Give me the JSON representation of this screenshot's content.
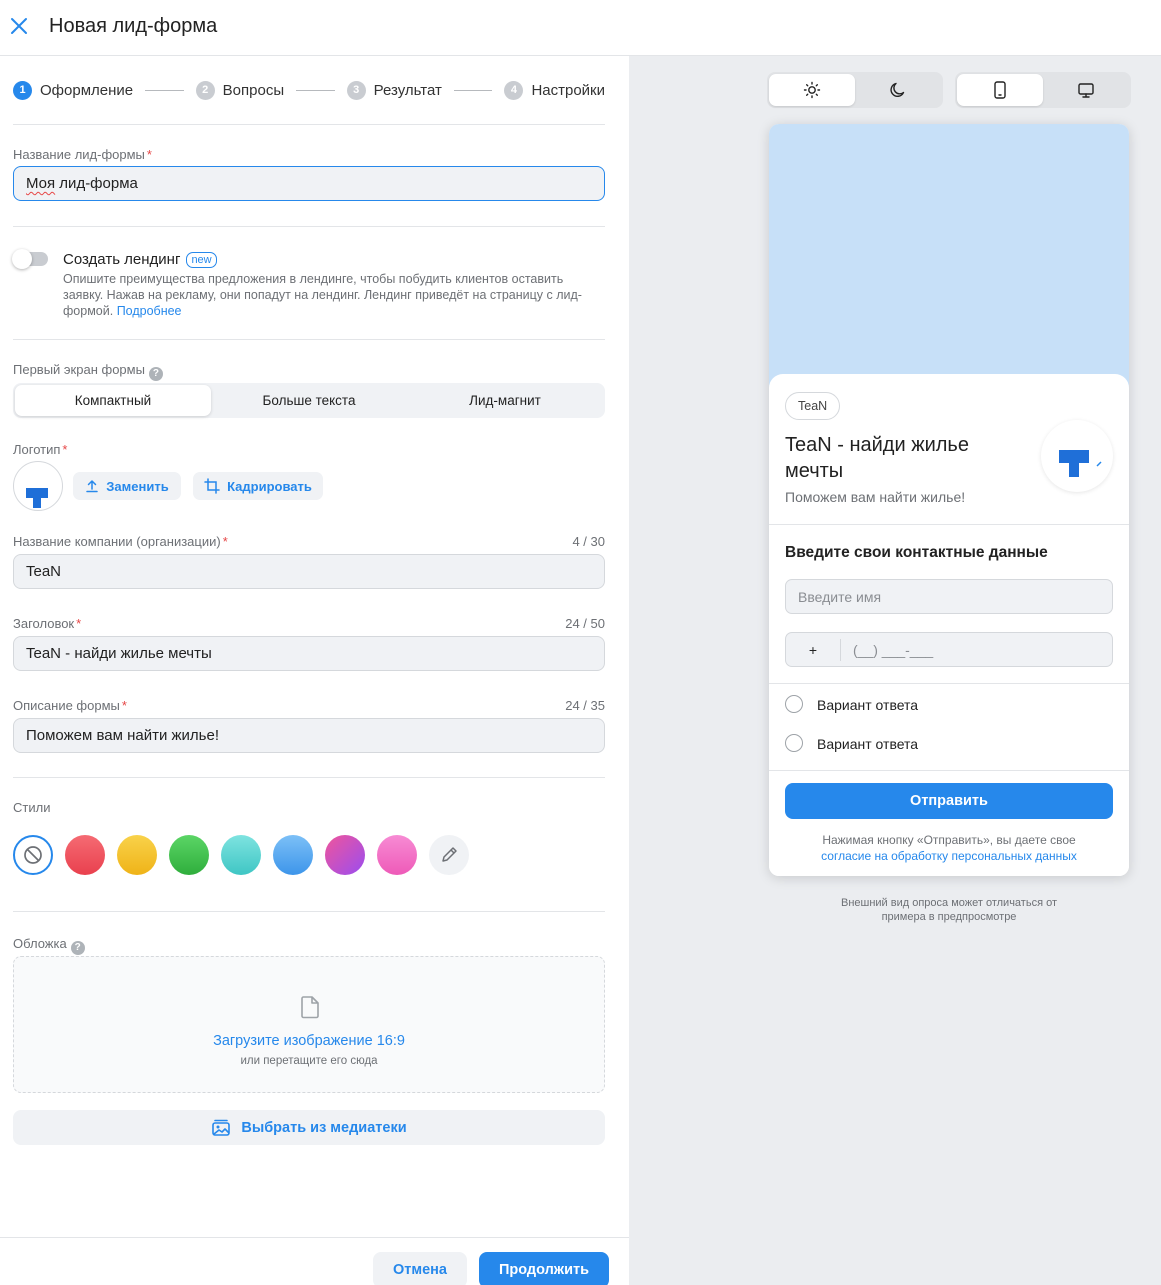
{
  "header": {
    "title": "Новая лид-форма"
  },
  "stepper": [
    {
      "num": "1",
      "label": "Оформление"
    },
    {
      "num": "2",
      "label": "Вопросы"
    },
    {
      "num": "3",
      "label": "Результат"
    },
    {
      "num": "4",
      "label": "Настройки"
    }
  ],
  "form_name": {
    "label": "Название лид-формы",
    "required": "*",
    "value_word1": "Моя",
    "value_rest": " лид-форма"
  },
  "landing": {
    "title": "Создать лендинг",
    "badge": "new",
    "description": "Опишите преимущества предложения в лендинге, чтобы побудить клиентов оставить заявку. Нажав на рекламу, они попадут на лендинг. Лендинг приведёт на страницу с лид-формой.",
    "link": "Подробнее"
  },
  "first_screen": {
    "label": "Первый экран формы",
    "help": "?",
    "options": [
      "Компактный",
      "Больше текста",
      "Лид-магнит"
    ],
    "selected": "Компактный"
  },
  "logo": {
    "label": "Логотип",
    "required": "*",
    "replace": "Заменить",
    "crop": "Кадрировать"
  },
  "company": {
    "label": "Название компании (организации)",
    "required": "*",
    "counter": "4 / 30",
    "value": "TeaN"
  },
  "headline": {
    "label": "Заголовок",
    "required": "*",
    "counter": "24 / 50",
    "value": "TeaN - найди жилье мечты"
  },
  "description": {
    "label": "Описание формы",
    "required": "*",
    "counter": "24 / 35",
    "value": "Поможем вам найти жилье!"
  },
  "styles": {
    "label": "Стили",
    "swatches": [
      "none",
      "red",
      "yellow",
      "green",
      "turquoise",
      "blue",
      "magenta",
      "pink",
      "picker"
    ],
    "colors": {
      "red": "#ef4f5c",
      "yellow": "#f5c02f",
      "green": "#3fbf4c",
      "turquoise": "#55d2d0",
      "blue": "#5aa9f2",
      "magenta": "#b545e6",
      "pink": "#f06bc4"
    }
  },
  "cover": {
    "label": "Обложка",
    "help": "?",
    "upload_title": "Загрузите изображение 16:9",
    "upload_sub": "или перетащите его сюда",
    "media_button": "Выбрать из медиатеки"
  },
  "footer": {
    "cancel": "Отмена",
    "continue": "Продолжить"
  },
  "preview": {
    "company": "TeaN",
    "title": "TeaN - найди жилье мечты",
    "description": "Поможем вам найти жилье!",
    "contacts_title": "Введите свои контактные данные",
    "name_placeholder": "Введите имя",
    "phone_prefix": "+",
    "phone_mask": "(__) ___-___",
    "answers": [
      "Вариант ответа",
      "Вариант ответа"
    ],
    "send": "Отправить",
    "consent_text": "Нажимая кнопку «Отправить», вы даете свое",
    "consent_link": "согласие на обработку персональных данных",
    "note": "Внешний вид опроса может отличаться от примера в предпросмотре"
  },
  "colors": {
    "accent": "#2688eb",
    "cover": "#c7e0f8",
    "panel_bg": "#ebedf0"
  }
}
